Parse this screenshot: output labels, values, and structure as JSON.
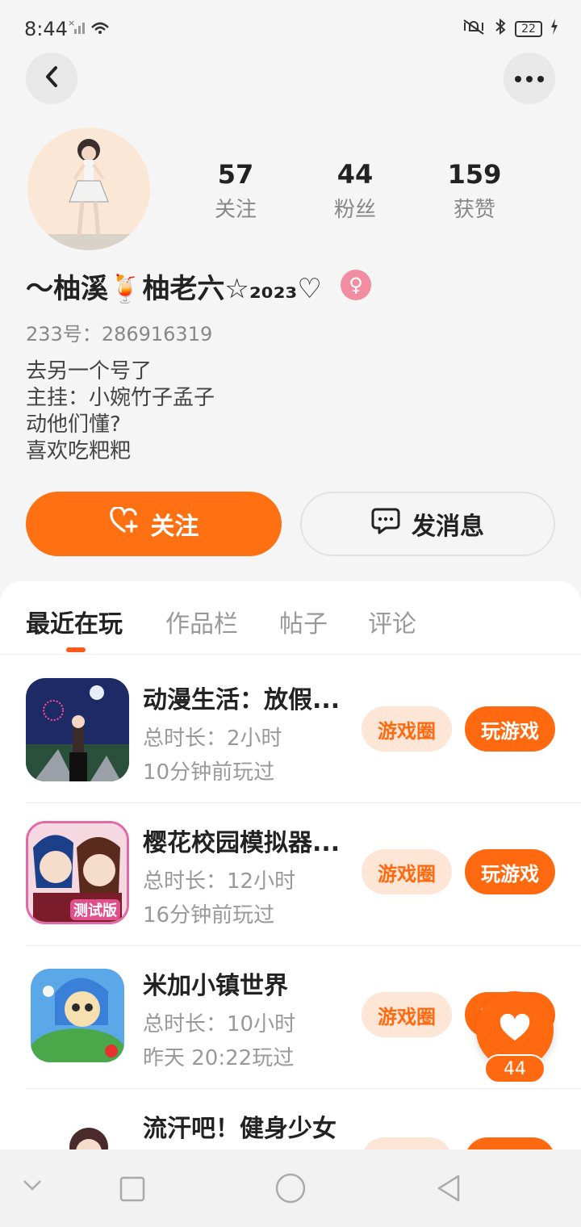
{
  "status_bar": {
    "time": "8:44",
    "signal": "×",
    "battery": "22"
  },
  "header": {
    "back_icon": "chevron-left-icon",
    "more_icon": "more-dots-icon"
  },
  "profile": {
    "stats": [
      {
        "num": "57",
        "label": "关注"
      },
      {
        "num": "44",
        "label": "粉丝"
      },
      {
        "num": "159",
        "label": "获赞"
      }
    ],
    "nickname": "～柚溪🍹柚老六☆₂₀₂₃♡",
    "gender_icon": "♀",
    "uid_label": "233号：",
    "uid": "286916319",
    "bio": [
      "去另一个号了",
      "主挂：小婉竹子孟子",
      "动他们懂?",
      "喜欢吃粑粑"
    ]
  },
  "actions": {
    "follow_label": "关注",
    "message_label": "发消息",
    "accent": "#ff7012"
  },
  "tabs": [
    {
      "label": "最近在玩"
    },
    {
      "label": "作品栏"
    },
    {
      "label": "帖子"
    },
    {
      "label": "评论"
    }
  ],
  "games": [
    {
      "name": "动漫生活：放假...",
      "duration": "总时长：2小时",
      "last": "10分钟前玩过",
      "circle_label": "游戏圈",
      "play_label": "玩游戏"
    },
    {
      "name": "樱花校园模拟器...",
      "duration": "总时长：12小时",
      "last": "16分钟前玩过",
      "circle_label": "游戏圈",
      "play_label": "玩游戏",
      "icon_badge": "测试版"
    },
    {
      "name": "米加小镇世界",
      "duration": "总时长：10小时",
      "last": "昨天 20:22玩过",
      "circle_label": "游戏圈",
      "play_label": "玩游戏"
    },
    {
      "name": "流汗吧！健身少女",
      "duration": "",
      "last": "",
      "circle_label": "",
      "play_label": ""
    }
  ],
  "fab": {
    "like_count": "44"
  }
}
